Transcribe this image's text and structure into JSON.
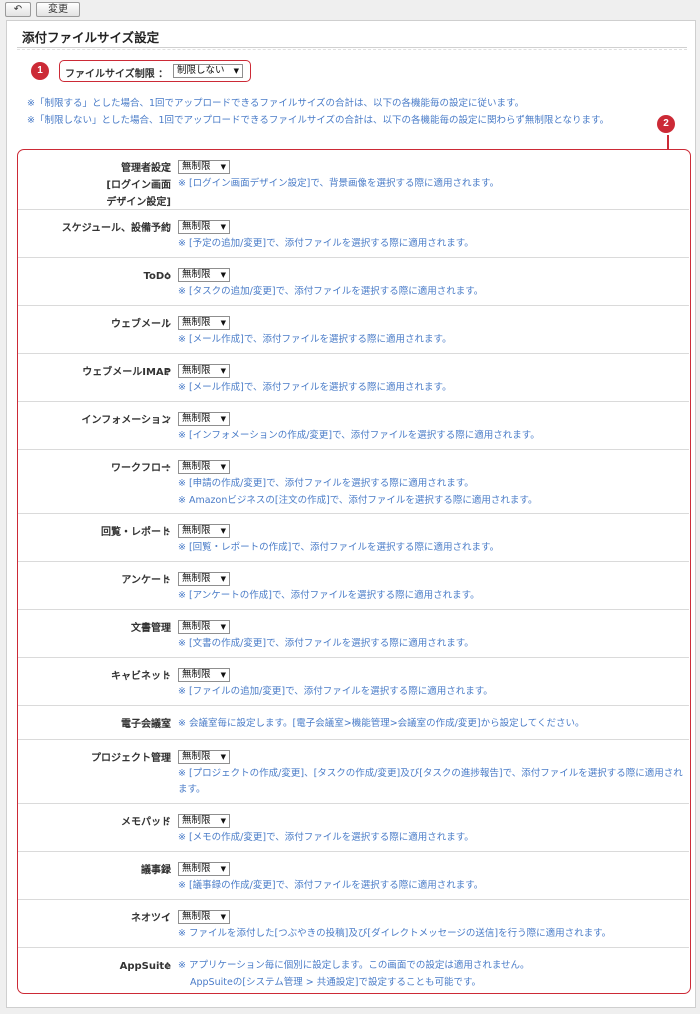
{
  "toolbar": {
    "back_icon": "↶",
    "change_label": "変更"
  },
  "page_title": "添付ファイルサイズ設定",
  "badges": {
    "one": "1",
    "two": "2"
  },
  "file_size_limit": {
    "label": "ファイルサイズ制限 ：",
    "value": "制限しない"
  },
  "notes": [
    "※「制限する」とした場合、1回でアップロードできるファイルサイズの合計は、以下の各機能毎の設定に従います。",
    "※「制限しない」とした場合、1回でアップロードできるファイルサイズの合計は、以下の各機能毎の設定に関わらず無制限となります。"
  ],
  "dropdown_arrow": "▼",
  "colon": "：",
  "rows": [
    {
      "label_lines": [
        "管理者設定",
        "[ログイン画面",
        "デザイン設定]"
      ],
      "select": "無制限",
      "notes": [
        "※ [ログイン画面デザイン設定]で、背景画像を選択する際に適用されます。"
      ]
    },
    {
      "label_lines": [
        "スケジュール、設備予約"
      ],
      "select": "無制限",
      "notes": [
        "※ [予定の追加/変更]で、添付ファイルを選択する際に適用されます。"
      ]
    },
    {
      "label_lines": [
        "ToDo"
      ],
      "select": "無制限",
      "notes": [
        "※ [タスクの追加/変更]で、添付ファイルを選択する際に適用されます。"
      ]
    },
    {
      "label_lines": [
        "ウェブメール"
      ],
      "select": "無制限",
      "notes": [
        "※ [メール作成]で、添付ファイルを選択する際に適用されます。"
      ]
    },
    {
      "label_lines": [
        "ウェブメールIMAP"
      ],
      "select": "無制限",
      "notes": [
        "※ [メール作成]で、添付ファイルを選択する際に適用されます。"
      ]
    },
    {
      "label_lines": [
        "インフォメーション"
      ],
      "select": "無制限",
      "notes": [
        "※ [インフォメーションの作成/変更]で、添付ファイルを選択する際に適用されます。"
      ]
    },
    {
      "label_lines": [
        "ワークフロー"
      ],
      "select": "無制限",
      "notes": [
        "※ [申請の作成/変更]で、添付ファイルを選択する際に適用されます。",
        "※ Amazonビジネスの[注文の作成]で、添付ファイルを選択する際に適用されます。"
      ]
    },
    {
      "label_lines": [
        "回覧・レポート"
      ],
      "select": "無制限",
      "notes": [
        "※ [回覧・レポートの作成]で、添付ファイルを選択する際に適用されます。"
      ]
    },
    {
      "label_lines": [
        "アンケート"
      ],
      "select": "無制限",
      "notes": [
        "※ [アンケートの作成]で、添付ファイルを選択する際に適用されます。"
      ]
    },
    {
      "label_lines": [
        "文書管理"
      ],
      "select": "無制限",
      "notes": [
        "※ [文書の作成/変更]で、添付ファイルを選択する際に適用されます。"
      ]
    },
    {
      "label_lines": [
        "キャビネット"
      ],
      "select": "無制限",
      "notes": [
        "※ [ファイルの追加/変更]で、添付ファイルを選択する際に適用されます。"
      ]
    },
    {
      "label_lines": [
        "電子会議室"
      ],
      "select": "",
      "notes": [
        "※ 会議室毎に設定します。[電子会議室>機能管理>会議室の作成/変更]から設定してください。"
      ]
    },
    {
      "label_lines": [
        "プロジェクト管理"
      ],
      "select": "無制限",
      "notes": [
        "※ [プロジェクトの作成/変更]、[タスクの作成/変更]及び[タスクの進捗報告]で、添付ファイルを選択する際に適用されます。"
      ]
    },
    {
      "label_lines": [
        "メモパッド"
      ],
      "select": "無制限",
      "notes": [
        "※ [メモの作成/変更]で、添付ファイルを選択する際に適用されます。"
      ]
    },
    {
      "label_lines": [
        "議事録"
      ],
      "select": "無制限",
      "notes": [
        "※ [議事録の作成/変更]で、添付ファイルを選択する際に適用されます。"
      ]
    },
    {
      "label_lines": [
        "ネオツイ"
      ],
      "select": "無制限",
      "notes": [
        "※ ファイルを添付した[つぶやきの投稿]及び[ダイレクトメッセージの送信]を行う際に適用されます。"
      ]
    },
    {
      "label_lines": [
        "AppSuite"
      ],
      "select": "",
      "notes": [
        "※ アプリケーション毎に個別に設定します。この画面での設定は適用されません。",
        "AppSuiteの[システム管理 > 共通設定]で設定することも可能です。"
      ]
    }
  ]
}
